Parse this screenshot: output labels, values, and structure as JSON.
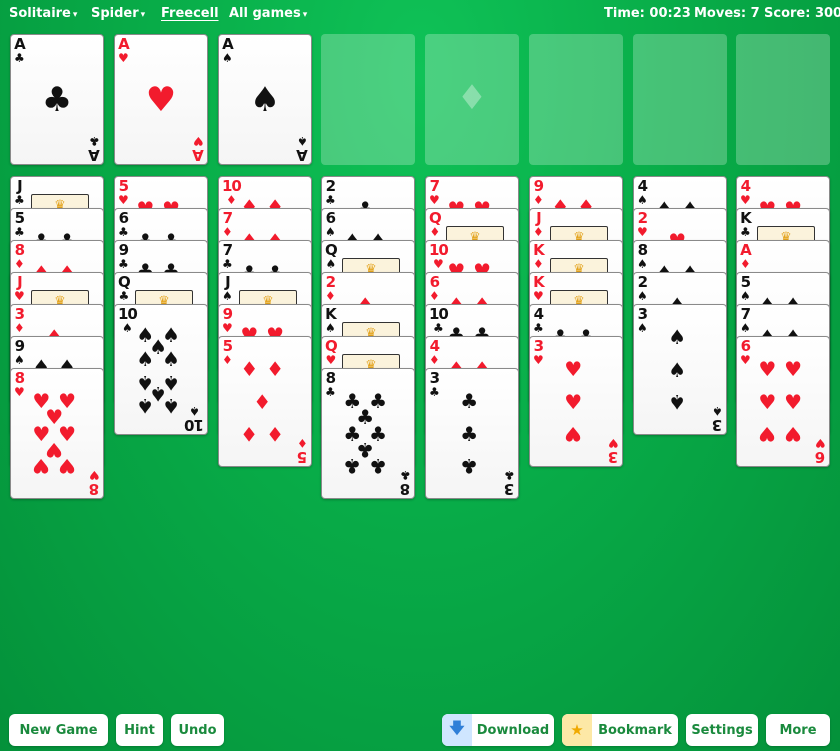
{
  "menu": [
    {
      "label": "Solitaire",
      "arrow": "▾",
      "active": false
    },
    {
      "label": "Spider",
      "arrow": "▾",
      "active": false
    },
    {
      "label": "Freecell",
      "arrow": "",
      "active": true
    },
    {
      "label": "All games",
      "arrow": "▾",
      "active": false
    }
  ],
  "stats": {
    "time": "Time: 00:23",
    "moves": "Moves: 7",
    "score": "Score: 300"
  },
  "free_cells": [
    {
      "rank": "A",
      "suit": "clubs"
    },
    {
      "rank": "A",
      "suit": "hearts"
    },
    {
      "rank": "A",
      "suit": "spades"
    },
    null
  ],
  "foundations": [
    {
      "placeholder_suit": "diamonds"
    },
    {
      "placeholder_suit": ""
    },
    {
      "placeholder_suit": ""
    },
    {
      "placeholder_suit": ""
    }
  ],
  "tableau": [
    [
      {
        "rank": "J",
        "suit": "clubs"
      },
      {
        "rank": "5",
        "suit": "clubs"
      },
      {
        "rank": "8",
        "suit": "diamonds"
      },
      {
        "rank": "J",
        "suit": "hearts"
      },
      {
        "rank": "3",
        "suit": "diamonds"
      },
      {
        "rank": "9",
        "suit": "spades"
      },
      {
        "rank": "8",
        "suit": "hearts"
      }
    ],
    [
      {
        "rank": "5",
        "suit": "hearts"
      },
      {
        "rank": "6",
        "suit": "clubs"
      },
      {
        "rank": "9",
        "suit": "clubs"
      },
      {
        "rank": "Q",
        "suit": "clubs"
      },
      {
        "rank": "10",
        "suit": "spades"
      }
    ],
    [
      {
        "rank": "10",
        "suit": "diamonds"
      },
      {
        "rank": "7",
        "suit": "diamonds"
      },
      {
        "rank": "7",
        "suit": "clubs"
      },
      {
        "rank": "J",
        "suit": "spades"
      },
      {
        "rank": "9",
        "suit": "hearts"
      },
      {
        "rank": "5",
        "suit": "diamonds"
      }
    ],
    [
      {
        "rank": "2",
        "suit": "clubs"
      },
      {
        "rank": "6",
        "suit": "spades"
      },
      {
        "rank": "Q",
        "suit": "spades"
      },
      {
        "rank": "2",
        "suit": "diamonds"
      },
      {
        "rank": "K",
        "suit": "spades"
      },
      {
        "rank": "Q",
        "suit": "hearts"
      },
      {
        "rank": "8",
        "suit": "clubs"
      }
    ],
    [
      {
        "rank": "7",
        "suit": "hearts"
      },
      {
        "rank": "Q",
        "suit": "diamonds"
      },
      {
        "rank": "10",
        "suit": "hearts"
      },
      {
        "rank": "6",
        "suit": "diamonds"
      },
      {
        "rank": "10",
        "suit": "clubs"
      },
      {
        "rank": "4",
        "suit": "diamonds"
      },
      {
        "rank": "3",
        "suit": "clubs"
      }
    ],
    [
      {
        "rank": "9",
        "suit": "diamonds"
      },
      {
        "rank": "J",
        "suit": "diamonds"
      },
      {
        "rank": "K",
        "suit": "diamonds"
      },
      {
        "rank": "K",
        "suit": "hearts"
      },
      {
        "rank": "4",
        "suit": "clubs"
      },
      {
        "rank": "3",
        "suit": "hearts"
      }
    ],
    [
      {
        "rank": "4",
        "suit": "spades"
      },
      {
        "rank": "2",
        "suit": "hearts"
      },
      {
        "rank": "8",
        "suit": "spades"
      },
      {
        "rank": "2",
        "suit": "spades"
      },
      {
        "rank": "3",
        "suit": "spades"
      }
    ],
    [
      {
        "rank": "4",
        "suit": "hearts"
      },
      {
        "rank": "K",
        "suit": "clubs"
      },
      {
        "rank": "A",
        "suit": "diamonds"
      },
      {
        "rank": "5",
        "suit": "spades"
      },
      {
        "rank": "7",
        "suit": "spades"
      },
      {
        "rank": "6",
        "suit": "hearts"
      }
    ]
  ],
  "buttons": [
    {
      "label": "New Game",
      "icon": "",
      "icon_bg": ""
    },
    {
      "label": "Hint",
      "icon": "",
      "icon_bg": ""
    },
    {
      "label": "Undo",
      "icon": "",
      "icon_bg": ""
    },
    {
      "label": "Download",
      "icon": "download-arrow-icon",
      "icon_bg": "#cfe6ff"
    },
    {
      "label": "Bookmark",
      "icon": "star-icon",
      "icon_bg": "#fde8a6"
    },
    {
      "label": "Settings",
      "icon": "",
      "icon_bg": ""
    },
    {
      "label": "More",
      "icon": "",
      "icon_bg": ""
    }
  ],
  "colors": {
    "table": "#08ac48",
    "red_suit": "#f21b2d",
    "black_suit": "#111111",
    "button_text": "#1a8a3d"
  }
}
